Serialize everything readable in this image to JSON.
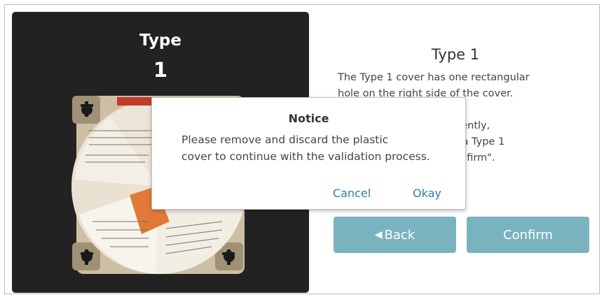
{
  "left_panel": {
    "type_label": "Type",
    "type_number": "1"
  },
  "right_panel": {
    "title": "Type 1",
    "description_lines": [
      "The Type 1 cover has one rectangular",
      "hole on the right side of the cover.",
      "",
      "If your cover looks differently,",
      "select Back. If you have a Type 1",
      "cover, please select \"Confirm\"."
    ]
  },
  "buttons": {
    "back": "Back",
    "back_icon": "triangle-left-icon",
    "confirm": "Confirm"
  },
  "dialog": {
    "title": "Notice",
    "message_lines": [
      "Please remove and discard the plastic",
      "cover to continue with the validation process."
    ],
    "cancel": "Cancel",
    "okay": "Okay"
  },
  "colors": {
    "panel_bg": "#222222",
    "button_bg": "#7ab3c0",
    "dialog_link": "#2f7ea8"
  }
}
